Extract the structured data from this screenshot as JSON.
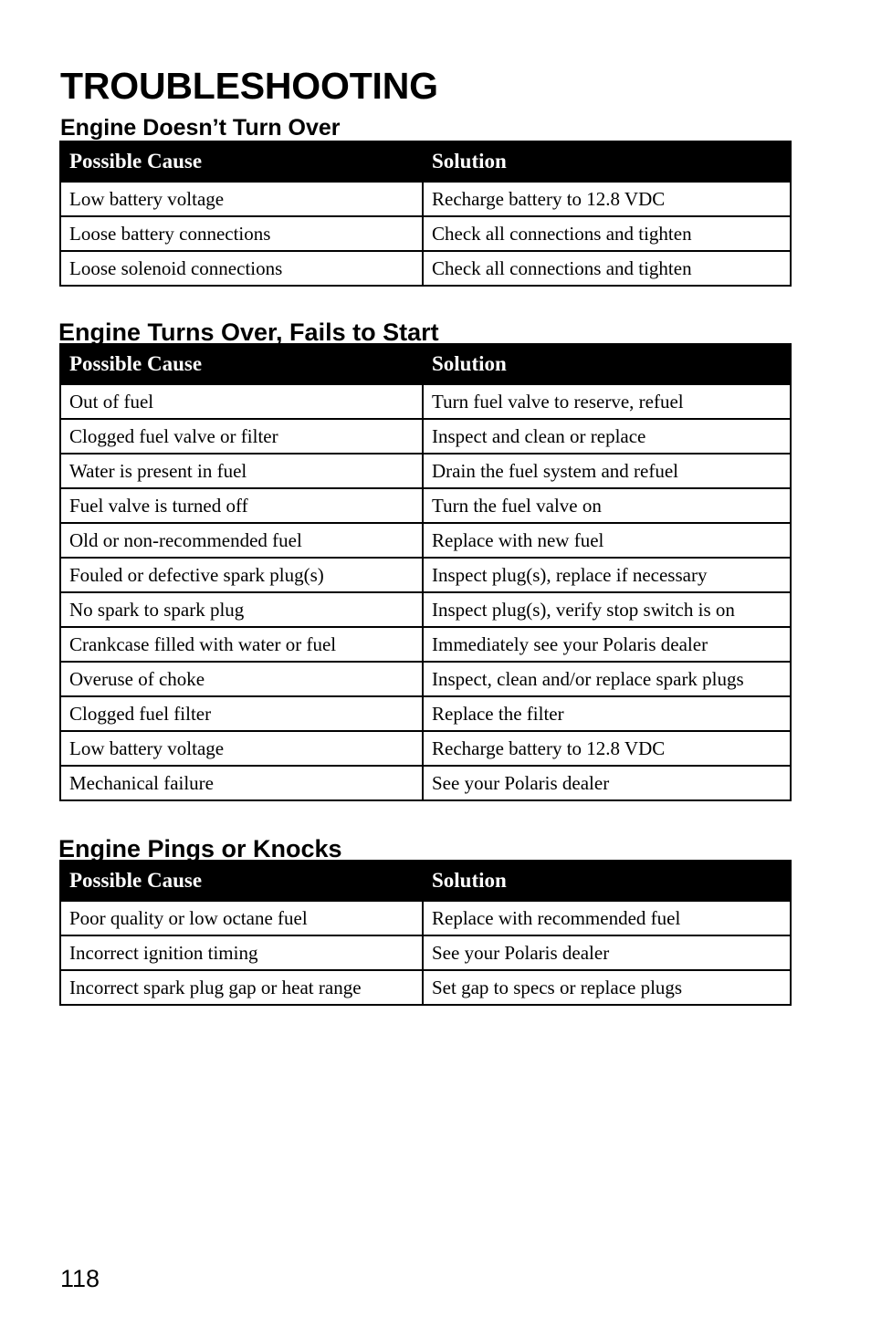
{
  "document": {
    "title": "TROUBLESHOOTING",
    "page_number": "118"
  },
  "columns": {
    "cause": "Possible Cause",
    "solution": "Solution"
  },
  "sections": [
    {
      "heading": "Engine Doesn’t Turn Over",
      "columns": [
        "Possible Cause",
        "Solution"
      ],
      "rows": [
        [
          "Low battery voltage",
          "Recharge battery to 12.8 VDC"
        ],
        [
          "Loose battery connections",
          "Check all connections and tighten"
        ],
        [
          "Loose solenoid connections",
          "Check all connections and tighten"
        ]
      ]
    },
    {
      "heading": "Engine Turns Over, Fails to Start",
      "columns": [
        "Possible Cause",
        "Solution"
      ],
      "rows": [
        [
          "Out of fuel",
          "Turn fuel valve to reserve, refuel"
        ],
        [
          "Clogged fuel valve or filter",
          "Inspect and clean or replace"
        ],
        [
          "Water is present in fuel",
          "Drain the fuel system and refuel"
        ],
        [
          "Fuel valve is turned off",
          "Turn the fuel valve on"
        ],
        [
          "Old or non-recommended fuel",
          "Replace with new fuel"
        ],
        [
          "Fouled or defective spark plug(s)",
          "Inspect plug(s), replace if necessary"
        ],
        [
          "No spark to spark plug",
          "Inspect plug(s), verify stop switch is on"
        ],
        [
          "Crankcase filled with water or fuel",
          "Immediately see your Polaris dealer"
        ],
        [
          "Overuse of choke",
          "Inspect, clean and/or replace spark plugs"
        ],
        [
          "Clogged fuel filter",
          "Replace the filter"
        ],
        [
          "Low battery voltage",
          "Recharge battery to 12.8 VDC"
        ],
        [
          "Mechanical failure",
          "See your Polaris dealer"
        ]
      ]
    },
    {
      "heading": "Engine Pings or Knocks",
      "columns": [
        "Possible Cause",
        "Solution"
      ],
      "rows": [
        [
          "Poor quality or low octane fuel",
          "Replace with recommended fuel"
        ],
        [
          "Incorrect ignition timing",
          "See your Polaris dealer"
        ],
        [
          "Incorrect spark plug gap or heat range",
          "Set gap to specs or replace plugs"
        ]
      ]
    }
  ],
  "colors": {
    "header_background": "#000000",
    "header_text": "#ffffff",
    "body_text": "#000000",
    "page_background": "#ffffff",
    "border": "#000000"
  }
}
